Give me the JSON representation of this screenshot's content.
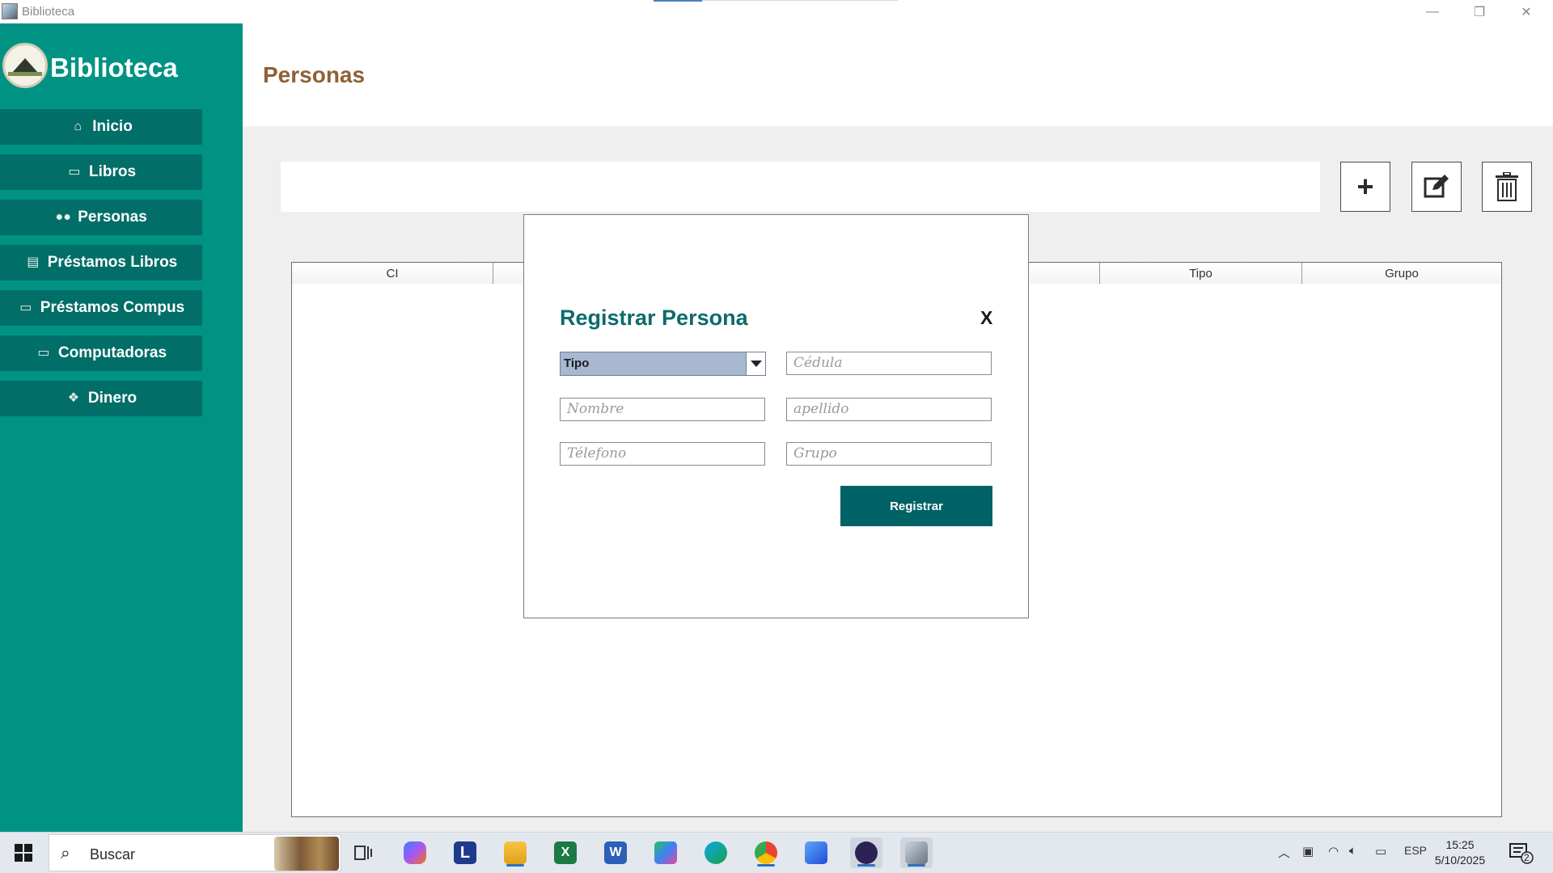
{
  "window": {
    "title": "Biblioteca",
    "minimize_glyph": "—",
    "maximize_glyph": "❐",
    "close_glyph": "✕"
  },
  "sidebar": {
    "brand": "Biblioteca",
    "items": [
      {
        "label": "Inicio",
        "icon": "home-icon"
      },
      {
        "label": "Libros",
        "icon": "book-icon"
      },
      {
        "label": "Personas",
        "icon": "people-icon"
      },
      {
        "label": "Préstamos Libros",
        "icon": "clipboard-icon"
      },
      {
        "label": "Préstamos Compus",
        "icon": "monitor-icon"
      },
      {
        "label": "Computadoras",
        "icon": "monitor-icon"
      },
      {
        "label": "Dinero",
        "icon": "money-icon"
      }
    ]
  },
  "header": {
    "title": "Personas"
  },
  "toolbar": {
    "add_glyph": "+"
  },
  "table": {
    "columns": [
      "CI",
      "",
      "",
      "",
      "Tipo",
      "Grupo"
    ]
  },
  "modal": {
    "title": "Registrar Persona",
    "close_label": "X",
    "tipo_select": "Tipo",
    "cedula_placeholder": "Cédula",
    "nombre_placeholder": "Nombre",
    "apellido_placeholder": "apellido",
    "telefono_placeholder": "Télefono",
    "grupo_placeholder": "Grupo",
    "submit_label": "Registrar"
  },
  "taskbar": {
    "search_label": "Buscar",
    "language": "ESP",
    "time": "15:25",
    "date": "5/10/2025",
    "notification_count": "2"
  },
  "colors": {
    "sidebar_bg": "#009384",
    "nav_item_bg": "#016e68",
    "title_color": "#8e6034",
    "modal_title": "#0d6b6c",
    "register_button": "#016266"
  }
}
